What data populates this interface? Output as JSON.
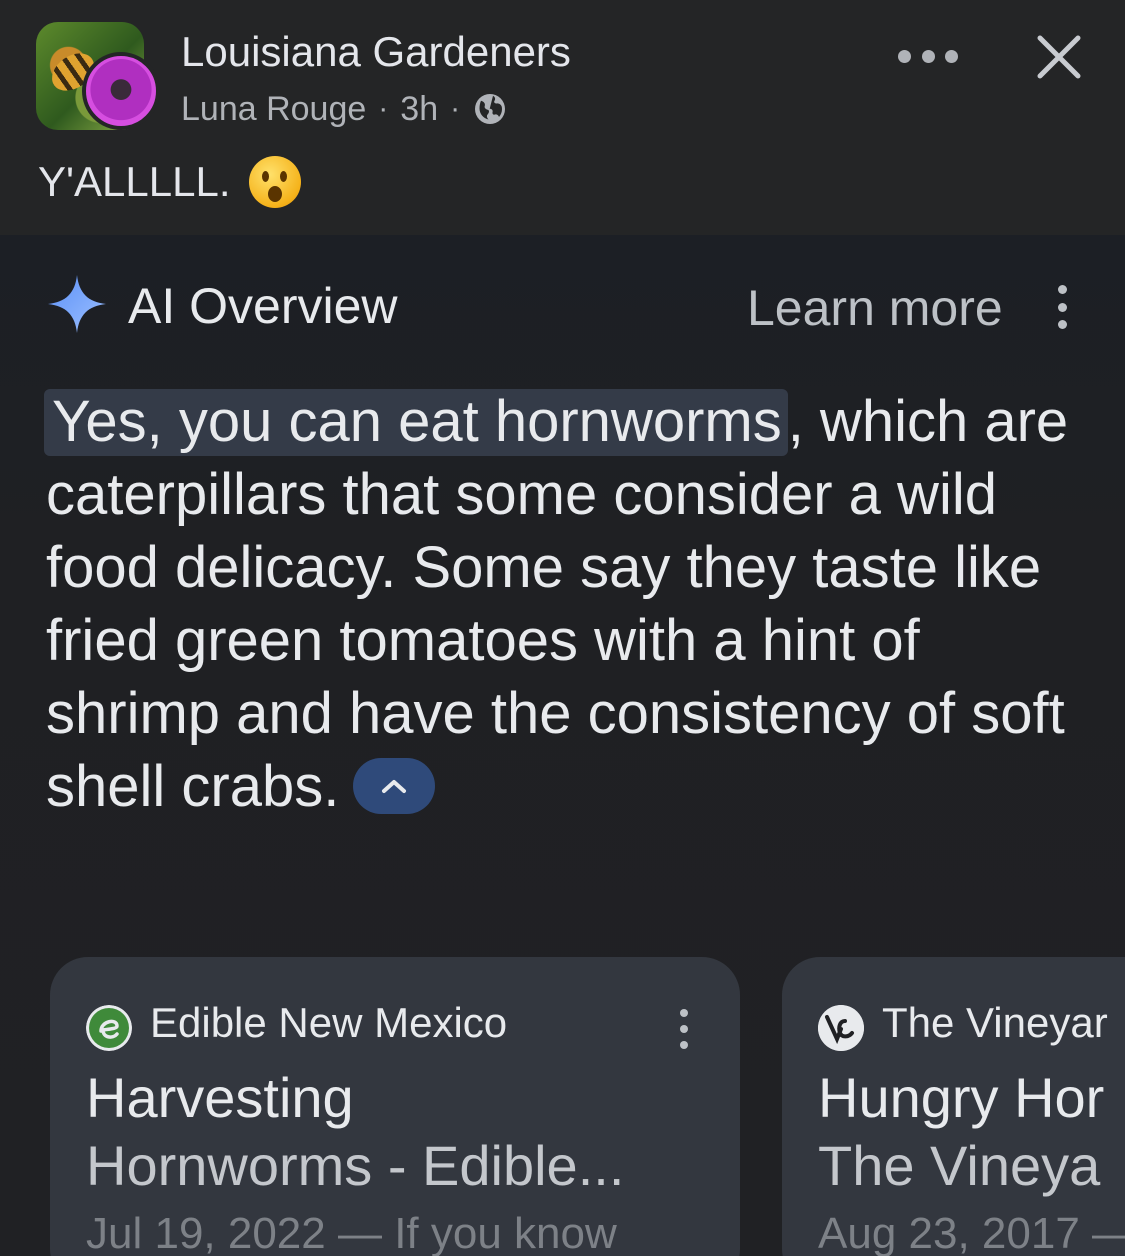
{
  "post": {
    "group_name": "Louisiana Gardeners",
    "author": "Luna Rouge",
    "separator": "·",
    "time": "3h",
    "text": "Y'ALLLLL.",
    "emoji_icon": "astonished-face-emoji"
  },
  "ai_overview": {
    "title": "AI Overview",
    "learn_more": "Learn more",
    "highlight": "Yes, you can eat hornworms",
    "body": ", which are caterpillars that some consider a wild food delicacy. Some say they taste like fried green tomatoes with a hint of shrimp and have the consistency of soft shell crabs.",
    "accent_color": "#8ab4f8"
  },
  "cards": [
    {
      "source": "Edible New Mexico",
      "title_line1": "Harvesting",
      "title_line2": "Hornworms - Edible...",
      "snippet": "Jul 19, 2022 — If you know"
    },
    {
      "source": "The Vineyar",
      "title_line1": "Hungry Hor",
      "title_line2": "The Vineya",
      "snippet": "Aug 23, 2017 —"
    }
  ]
}
